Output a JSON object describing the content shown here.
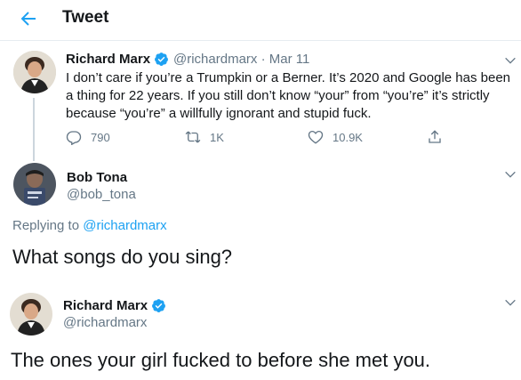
{
  "header": {
    "title": "Tweet"
  },
  "tweet1": {
    "name": "Richard Marx",
    "handle": "@richardmarx",
    "sep": "·",
    "date": "Mar 11",
    "text": "I don’t care if you’re a Trumpkin or a Berner. It’s 2020 and Google has been a thing for 22 years. If you still don’t know “your” from “you’re” it’s strictly because “you’re” a willfully ignorant and stupid fuck.",
    "replies": "790",
    "retweets": "1K",
    "likes": "10.9K"
  },
  "tweet2": {
    "name": "Bob Tona",
    "handle": "@bob_tona",
    "replying_prefix": "Replying to",
    "replying_to": "@richardmarx",
    "text": "What songs do you sing?"
  },
  "tweet3": {
    "name": "Richard Marx",
    "handle": "@richardmarx",
    "text": "The ones your girl fucked to before she met you."
  },
  "colors": {
    "accent": "#1da1f2",
    "muted": "#657786",
    "text": "#14171a",
    "divider": "#e6ecf0"
  },
  "icons": [
    "back-arrow-icon",
    "verified-icon",
    "chevron-down-icon",
    "reply-icon",
    "retweet-icon",
    "like-icon",
    "share-icon"
  ]
}
